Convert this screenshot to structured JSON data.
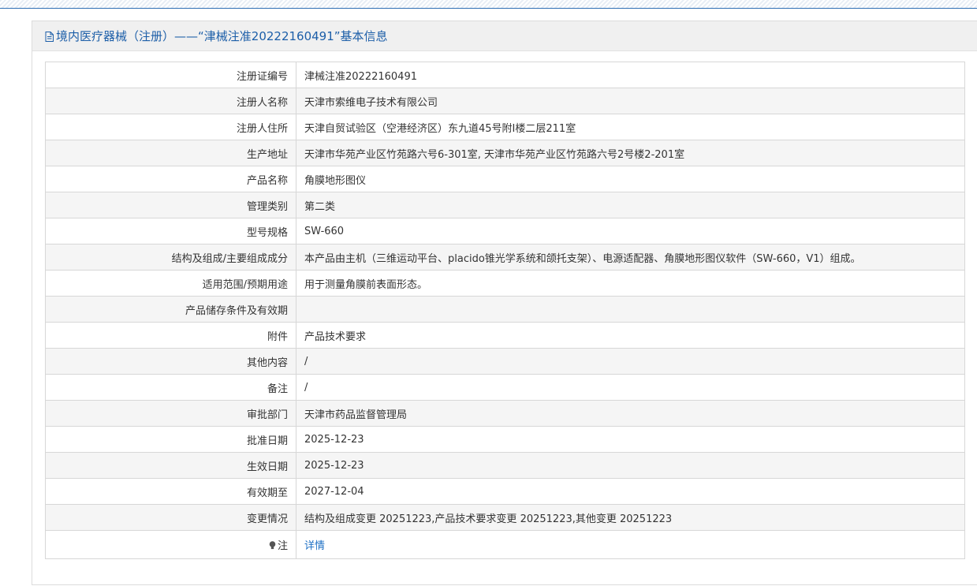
{
  "header": {
    "title": "境内医疗器械（注册）——“津械注准20222160491”基本信息",
    "icon": "document-icon"
  },
  "rows": [
    {
      "key": "registration-number",
      "label": "注册证编号",
      "value": "津械注准20222160491"
    },
    {
      "key": "registrant-name",
      "label": "注册人名称",
      "value": "天津市索维电子技术有限公司"
    },
    {
      "key": "registrant-address",
      "label": "注册人住所",
      "value": "天津自贸试验区（空港经济区）东九道45号附I楼二层211室"
    },
    {
      "key": "production-address",
      "label": "生产地址",
      "value": "天津市华苑产业区竹苑路六号6-301室, 天津市华苑产业区竹苑路六号2号楼2-201室"
    },
    {
      "key": "product-name",
      "label": "产品名称",
      "value": "角膜地形图仪"
    },
    {
      "key": "management-class",
      "label": "管理类别",
      "value": "第二类"
    },
    {
      "key": "model-spec",
      "label": "型号规格",
      "value": "SW-660"
    },
    {
      "key": "structure-composition",
      "label": "结构及组成/主要组成成分",
      "value": "本产品由主机（三维运动平台、placido锥光学系统和颌托支架）、电源适配器、角膜地形图仪软件（SW-660，V1）组成。"
    },
    {
      "key": "intended-use",
      "label": "适用范围/预期用途",
      "value": "用于测量角膜前表面形态。"
    },
    {
      "key": "storage-conditions",
      "label": "产品储存条件及有效期",
      "value": ""
    },
    {
      "key": "attachment",
      "label": "附件",
      "value": "产品技术要求"
    },
    {
      "key": "other-content",
      "label": "其他内容",
      "value": "/"
    },
    {
      "key": "remarks",
      "label": "备注",
      "value": "/"
    },
    {
      "key": "approval-department",
      "label": "审批部门",
      "value": "天津市药品监督管理局"
    },
    {
      "key": "approval-date",
      "label": "批准日期",
      "value": "2025-12-23"
    },
    {
      "key": "effective-date",
      "label": "生效日期",
      "value": "2025-12-23"
    },
    {
      "key": "expiry-date",
      "label": "有效期至",
      "value": "2027-12-04"
    },
    {
      "key": "change-status",
      "label": "变更情况",
      "value": "结构及组成变更 20251223,产品技术要求变更 20251223,其他变更 20251223"
    }
  ],
  "note": {
    "label": "注",
    "icon": "lightbulb-icon",
    "link_text": "详情"
  },
  "colors": {
    "accent": "#1c5ea8",
    "link": "#1c6fc4",
    "header_bg": "#f0f0f0",
    "stripe_bg": "#f5f5f5",
    "border": "#d7d7d7"
  }
}
